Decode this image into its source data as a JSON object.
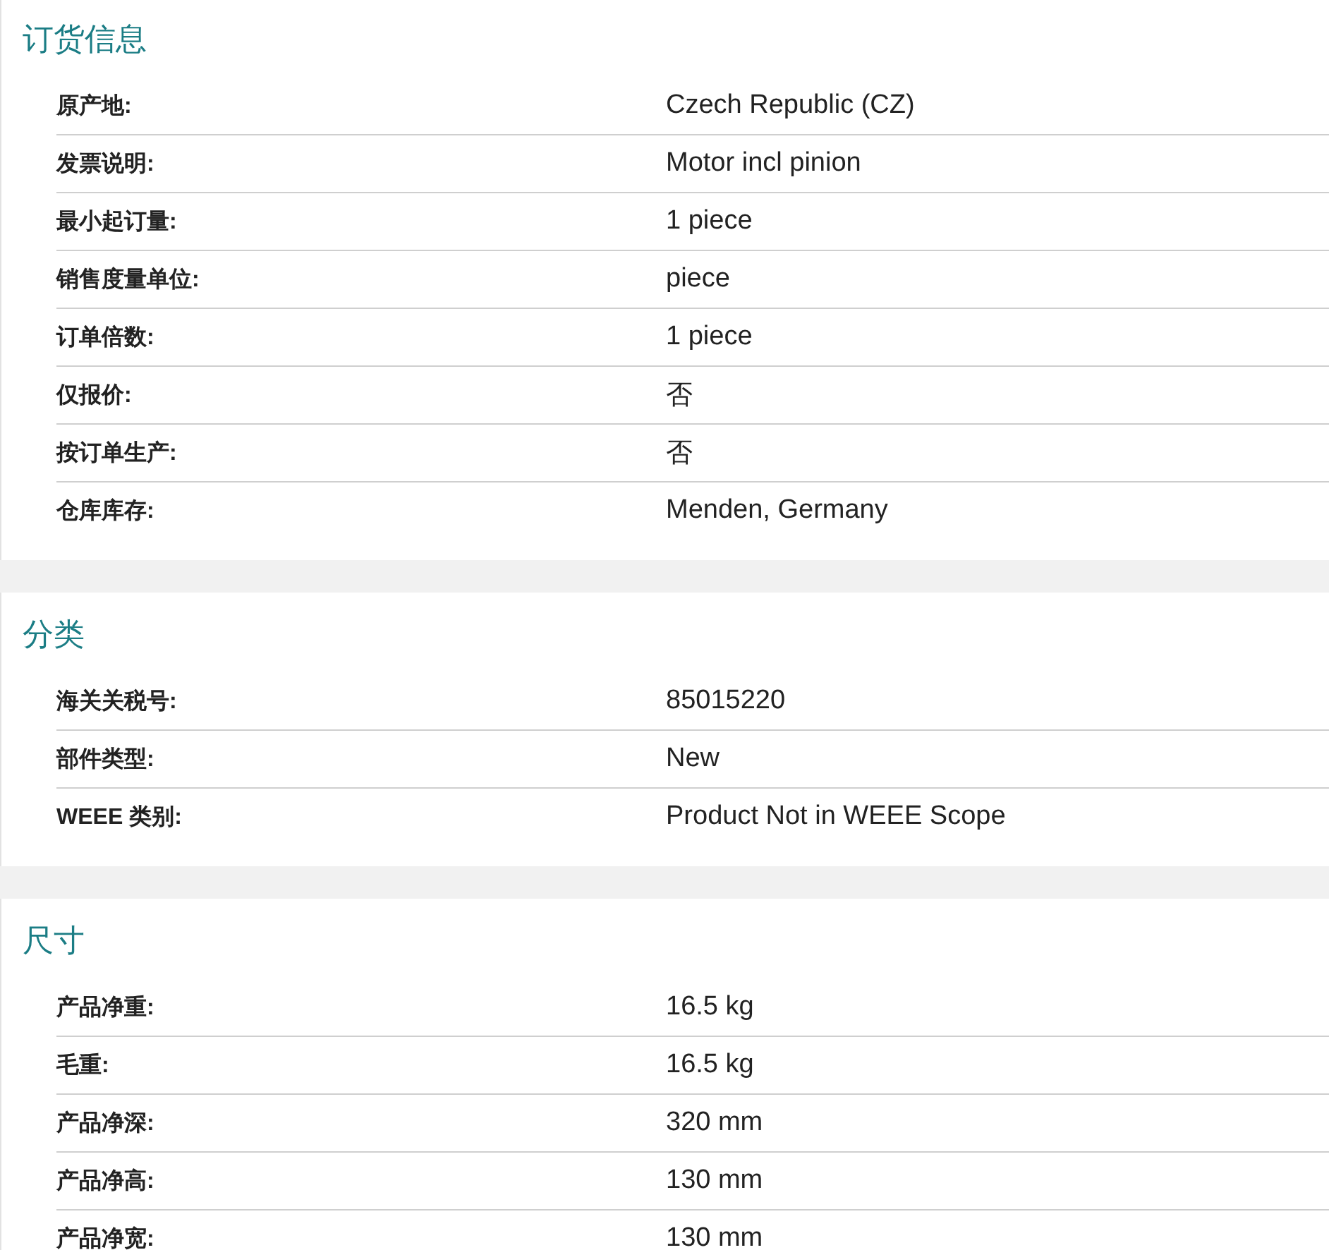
{
  "sections": [
    {
      "title": "订货信息",
      "rows": [
        {
          "label": "原产地:",
          "value": "Czech Republic (CZ)"
        },
        {
          "label": "发票说明:",
          "value": "Motor incl pinion"
        },
        {
          "label": "最小起订量:",
          "value": "1 piece"
        },
        {
          "label": "销售度量单位:",
          "value": "piece"
        },
        {
          "label": "订单倍数:",
          "value": "1 piece"
        },
        {
          "label": "仅报价:",
          "value": "否"
        },
        {
          "label": "按订单生产:",
          "value": "否"
        },
        {
          "label": "仓库库存:",
          "value": "Menden, Germany"
        }
      ]
    },
    {
      "title": "分类",
      "rows": [
        {
          "label": "海关关税号:",
          "value": "85015220"
        },
        {
          "label": "部件类型:",
          "value": "New"
        },
        {
          "label": "WEEE 类别:",
          "value": "Product Not in WEEE Scope"
        }
      ]
    },
    {
      "title": "尺寸",
      "rows": [
        {
          "label": "产品净重:",
          "value": "16.5 kg"
        },
        {
          "label": "毛重:",
          "value": "16.5 kg"
        },
        {
          "label": "产品净深:",
          "value": "320 mm"
        },
        {
          "label": "产品净高:",
          "value": "130 mm"
        },
        {
          "label": "产品净宽:",
          "value": "130 mm"
        }
      ]
    }
  ]
}
